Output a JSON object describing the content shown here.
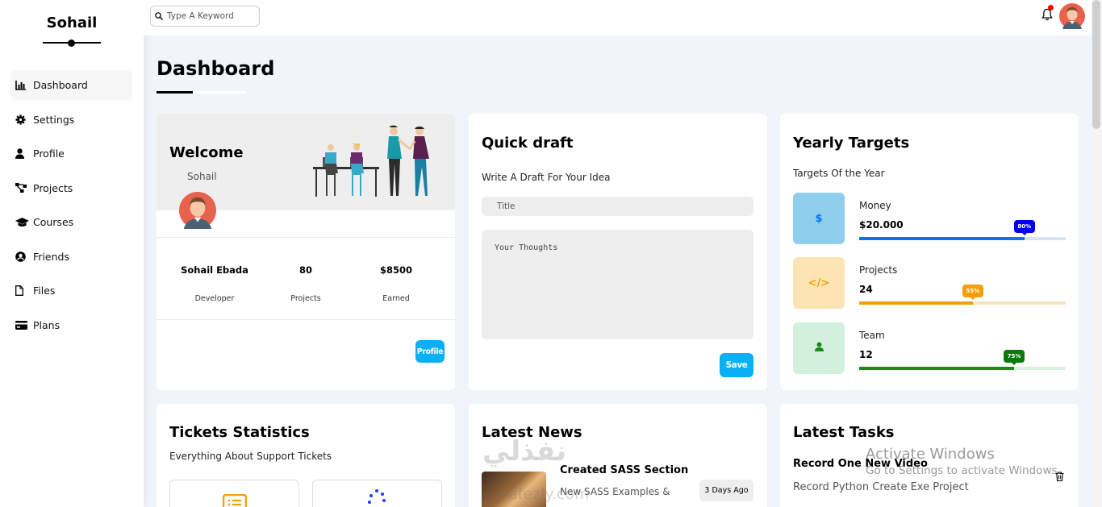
{
  "brand": {
    "name": "Sohail"
  },
  "sidebar": {
    "items": [
      {
        "label": "Dashboard",
        "icon": "chart-bar-icon",
        "active": true
      },
      {
        "label": "Settings",
        "icon": "gear-icon"
      },
      {
        "label": "Profile",
        "icon": "user-icon"
      },
      {
        "label": "Projects",
        "icon": "diagram-icon"
      },
      {
        "label": "Courses",
        "icon": "graduation-cap-icon"
      },
      {
        "label": "Friends",
        "icon": "user-circle-icon"
      },
      {
        "label": "Files",
        "icon": "file-icon"
      },
      {
        "label": "Plans",
        "icon": "credit-card-icon"
      }
    ]
  },
  "header": {
    "search_placeholder": "Type A Keyword",
    "notification_icon": "bell-icon"
  },
  "page": {
    "title": "Dashboard"
  },
  "welcome": {
    "title": "Welcome",
    "name": "Sohail",
    "stats": [
      {
        "value": "Sohail Ebada",
        "label": "Developer"
      },
      {
        "value": "80",
        "label": "Projects"
      },
      {
        "value": "$8500",
        "label": "Earned"
      }
    ],
    "button": "Profile"
  },
  "draft": {
    "title": "Quick draft",
    "subtitle": "Write A Draft For Your Idea",
    "title_placeholder": "Title",
    "body_placeholder": "Your Thoughts",
    "button": "Save"
  },
  "targets": {
    "title": "Yearly Targets",
    "subtitle": "Targets Of the Year",
    "items": [
      {
        "name": "Money",
        "value": "$20.000",
        "percent": 80,
        "percent_label": "80%",
        "icon_text": "$",
        "color": "#0075ff",
        "bg": "#8fcfed",
        "track": "#d7e3f7",
        "tip": "#0000ee"
      },
      {
        "name": "Projects",
        "value": "24",
        "percent": 55,
        "percent_label": "55%",
        "icon_text": "</>",
        "color": "#f59e0b",
        "bg": "#fde4b3",
        "track": "#f6e6c0",
        "tip": "#f59e0b"
      },
      {
        "name": "Team",
        "value": "12",
        "percent": 75,
        "percent_label": "75%",
        "icon_text": "team",
        "color": "#1a8a1a",
        "bg": "#d2f1dc",
        "track": "#d9f1df",
        "tip": "#0a7a0a"
      }
    ]
  },
  "tickets": {
    "title": "Tickets Statistics",
    "subtitle": "Everything About Support Tickets"
  },
  "news": {
    "title": "Latest News",
    "items": [
      {
        "title": "Created SASS Section",
        "desc": "New SASS Examples &",
        "badge": "3 Days Ago"
      }
    ]
  },
  "tasks": {
    "title": "Latest Tasks",
    "items": [
      {
        "title": "Record One New Video",
        "desc": "Record Python Create Exe Project"
      }
    ]
  },
  "overlay": {
    "activate_title": "Activate Windows",
    "activate_sub": "Go to Settings to activate Windows.",
    "watermark_ar": "نفذلي",
    "watermark_en": "nafezly.com"
  }
}
